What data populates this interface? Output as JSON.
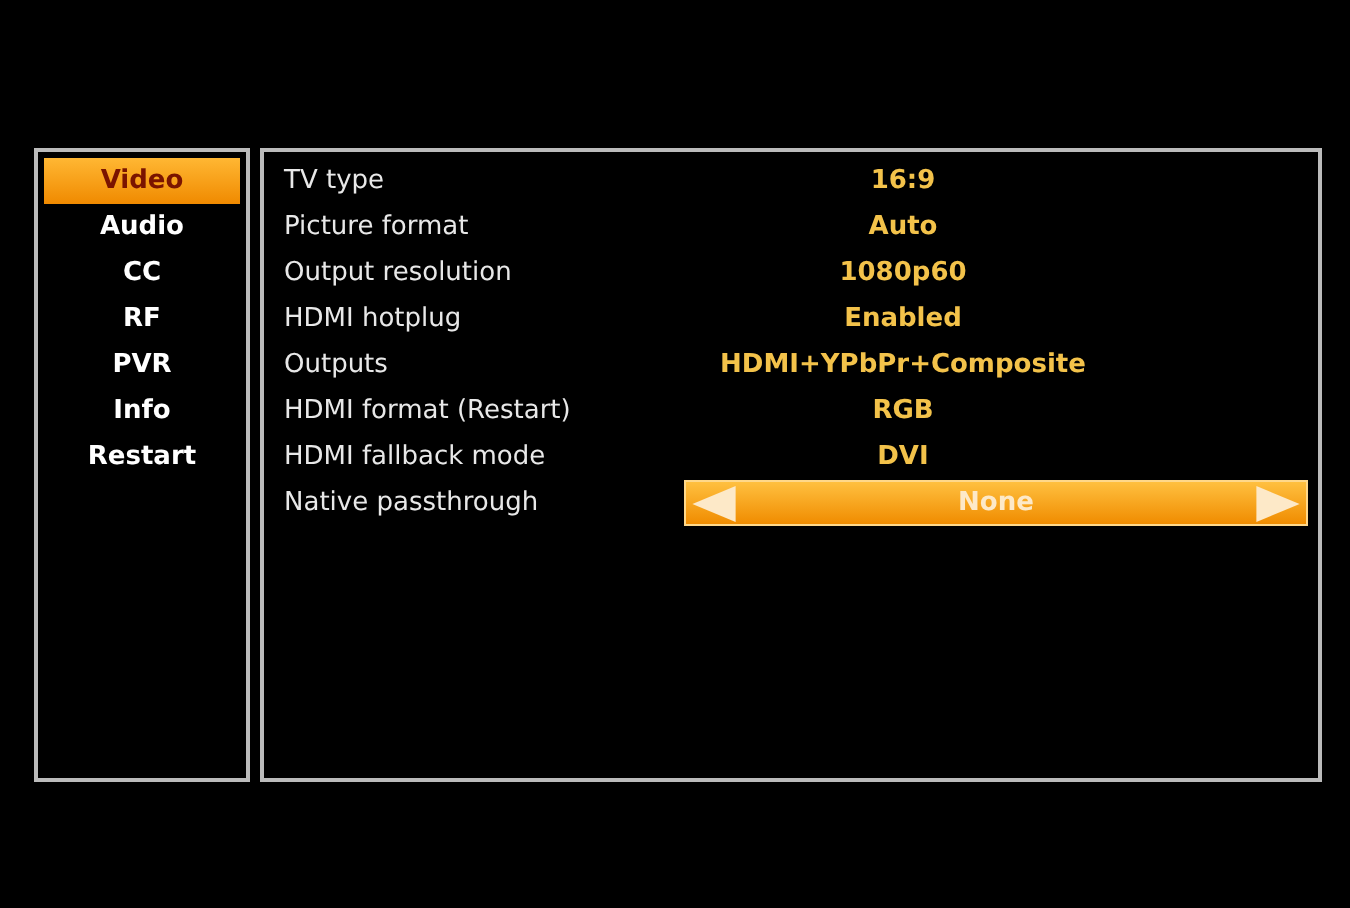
{
  "sidebar": {
    "items": [
      {
        "label": "Video",
        "selected": true
      },
      {
        "label": "Audio",
        "selected": false
      },
      {
        "label": "CC",
        "selected": false
      },
      {
        "label": "RF",
        "selected": false
      },
      {
        "label": "PVR",
        "selected": false
      },
      {
        "label": "Info",
        "selected": false
      },
      {
        "label": "Restart",
        "selected": false
      }
    ]
  },
  "settings": [
    {
      "label": "TV type",
      "value": "16:9",
      "selected": false
    },
    {
      "label": "Picture format",
      "value": "Auto",
      "selected": false
    },
    {
      "label": "Output resolution",
      "value": "1080p60",
      "selected": false
    },
    {
      "label": "HDMI hotplug",
      "value": "Enabled",
      "selected": false
    },
    {
      "label": "Outputs",
      "value": "HDMI+YPbPr+Composite",
      "selected": false
    },
    {
      "label": "HDMI format (Restart)",
      "value": "RGB",
      "selected": false
    },
    {
      "label": "HDMI fallback mode",
      "value": "DVI",
      "selected": false
    },
    {
      "label": "Native passthrough",
      "value": "None",
      "selected": true
    }
  ]
}
